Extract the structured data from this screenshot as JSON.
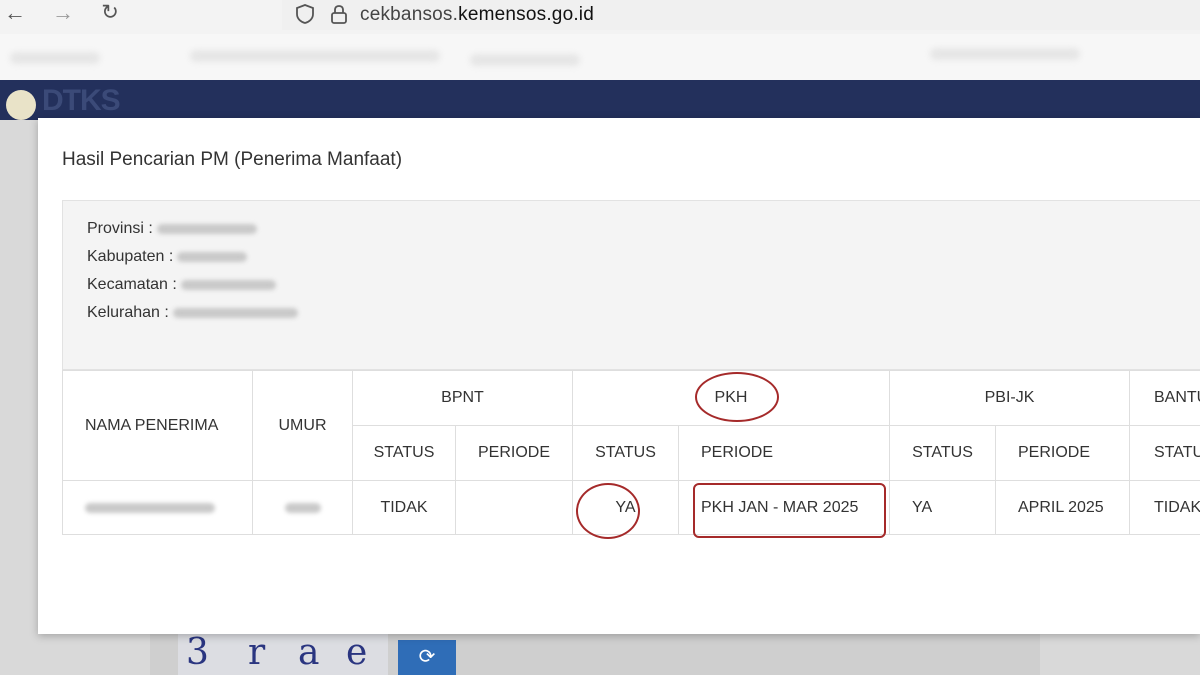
{
  "browser": {
    "back_icon": "arrow-left-icon",
    "forward_icon": "arrow-right-icon",
    "reload_icon": "reload-icon",
    "url_prefix": "cekbansos.",
    "url_domain": "kemensos.go.id"
  },
  "site": {
    "logo_text": "DTKS",
    "header_color": "#23305c"
  },
  "modal": {
    "title": "Hasil Pencarian PM (Penerima Manfaat)",
    "info": {
      "provinsi_label": "Provinsi :",
      "kabupaten_label": "Kabupaten :",
      "kecamatan_label": "Kecamatan :",
      "kelurahan_label": "Kelurahan :"
    }
  },
  "table": {
    "col_nama": "NAMA PENERIMA",
    "col_umur": "UMUR",
    "groups": [
      "BPNT",
      "PKH",
      "PBI-JK",
      "BANTU"
    ],
    "sub_status": "STATUS",
    "sub_periode": "PERIODE",
    "sub_status_cut": "STATU",
    "row": {
      "bpnt_status": "TIDAK",
      "bpnt_periode": "",
      "pkh_status": "YA",
      "pkh_periode": "PKH JAN - MAR 2025",
      "pbijk_status": "YA",
      "pbijk_periode": "APRIL 2025",
      "bantu_status": "TIDAK"
    }
  },
  "captcha": {
    "text": [
      "3",
      "r",
      "a",
      "e"
    ]
  },
  "colors": {
    "annotation": "#a52a2a",
    "refresh_button": "#2f6db7"
  }
}
